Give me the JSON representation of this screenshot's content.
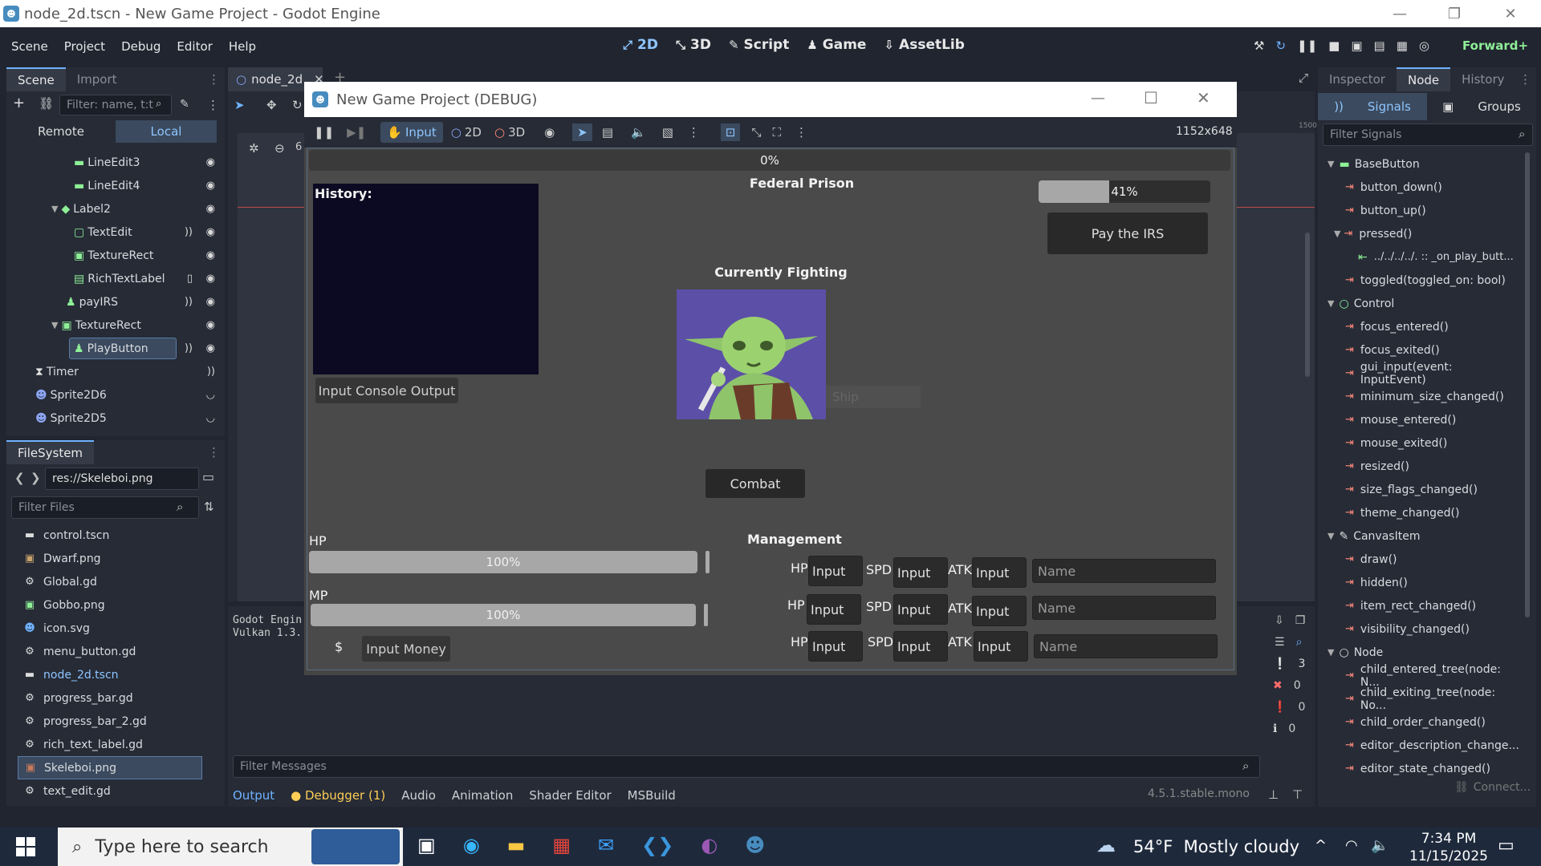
{
  "window": {
    "title": "node_2d.tscn - New Game Project - Godot Engine"
  },
  "menu": [
    "Scene",
    "Project",
    "Debug",
    "Editor",
    "Help"
  ],
  "workspaces": [
    {
      "label": "2D",
      "icon": "2d-icon",
      "active": true
    },
    {
      "label": "3D",
      "icon": "3d-icon",
      "active": false
    },
    {
      "label": "Script",
      "icon": "script-icon",
      "active": false
    },
    {
      "label": "Game",
      "icon": "game-icon",
      "active": false
    },
    {
      "label": "AssetLib",
      "icon": "assetlib-icon",
      "active": false
    }
  ],
  "renderer": "Forward+",
  "scene_dock": {
    "tabs": [
      "Scene",
      "Import"
    ],
    "filter_placeholder": "Filter: name, t:t",
    "remote": "Remote",
    "local": "Local",
    "nodes": [
      {
        "label": "LineEdit3",
        "depth": 3,
        "icon": "lineedit-icon",
        "color": "#8eef97"
      },
      {
        "label": "LineEdit4",
        "depth": 3,
        "icon": "lineedit-icon",
        "color": "#8eef97"
      },
      {
        "label": "Label2",
        "depth": 2,
        "icon": "label-icon",
        "color": "#8eef97"
      },
      {
        "label": "TextEdit",
        "depth": 3,
        "icon": "textedit-icon",
        "color": "#8eef97"
      },
      {
        "label": "TextureRect",
        "depth": 3,
        "icon": "texturerect-icon",
        "color": "#8eef97"
      },
      {
        "label": "RichTextLabel",
        "depth": 3,
        "icon": "richtextlabel-icon",
        "color": "#8eef97"
      },
      {
        "label": "payIRS",
        "depth": 2,
        "icon": "button-icon",
        "color": "#8eef97"
      },
      {
        "label": "TextureRect",
        "depth": 2,
        "icon": "texturerect-icon",
        "color": "#8eef97"
      },
      {
        "label": "PlayButton",
        "depth": 3,
        "icon": "button-icon",
        "color": "#8eef97"
      },
      {
        "label": "Timer",
        "depth": 1,
        "icon": "timer-icon",
        "color": "#e0e0e0"
      },
      {
        "label": "Sprite2D6",
        "depth": 1,
        "icon": "sprite-icon",
        "color": "#8da5f3"
      },
      {
        "label": "Sprite2D5",
        "depth": 1,
        "icon": "sprite-icon",
        "color": "#8da5f3"
      }
    ]
  },
  "filesystem": {
    "title": "FileSystem",
    "path": "res://Skeleboi.png",
    "filter_placeholder": "Filter Files",
    "files": [
      "control.tscn",
      "Dwarf.png",
      "Global.gd",
      "Gobbo.png",
      "icon.svg",
      "menu_button.gd",
      "node_2d.tscn",
      "progress_bar.gd",
      "progress_bar_2.gd",
      "rich_text_label.gd",
      "Skeleboi.png",
      "text_edit.gd"
    ]
  },
  "editor": {
    "tab": "node_2d",
    "log_line1": "Godot Engin",
    "log_line2": "Vulkan 1.3.",
    "zoom_fragment": "6",
    "ruler_1500": "1500",
    "filter_messages": "Filter Messages",
    "counts": [
      "3",
      "0",
      "0",
      "0"
    ]
  },
  "bottom_tabs": [
    "Output",
    "Debugger (1)",
    "Audio",
    "Animation",
    "Shader Editor",
    "MSBuild"
  ],
  "version": "4.5.1.stable.mono",
  "debug_window": {
    "title": "New Game Project (DEBUG)",
    "toolbar": {
      "input": "Input",
      "d2": "2D",
      "d3": "3D",
      "resolution": "1152x648"
    },
    "top_progress": "0%",
    "location": "Federal Prison",
    "history_label": "History:",
    "input_console_button": "Input Console Output",
    "irs_progress_text": "41%",
    "irs_progress": 0.41,
    "pay_irs_button": "Pay the IRS",
    "currently_fighting": "Currently Fighting",
    "ghost_text": "Ship",
    "combat_button": "Combat",
    "hp_label": "HP",
    "hp_text": "100%",
    "hp_value": 1.0,
    "mp_label": "MP",
    "mp_text": "100%",
    "mp_value": 1.0,
    "money_symbol": "$",
    "money_button": "Input Money",
    "management": "Management",
    "rows": [
      {
        "hp": "HP",
        "hp_val": "Input",
        "spd": "SPD",
        "spd_val": "Input",
        "atk": "ATK",
        "atk_val": "Input",
        "name": "Name"
      },
      {
        "hp": "HP",
        "hp_val": "Input",
        "spd": "SPD",
        "spd_val": "Input",
        "atk": "ATK",
        "atk_val": "Input",
        "name": "Name"
      },
      {
        "hp": "HP",
        "hp_val": "Input",
        "spd": "SPD",
        "spd_val": "Input",
        "atk": "ATK",
        "atk_val": "Input",
        "name": "Name"
      }
    ]
  },
  "inspector": {
    "tabs": [
      "Inspector",
      "Node",
      "History"
    ],
    "subtabs": [
      "Signals",
      "Groups"
    ],
    "filter_placeholder": "Filter Signals",
    "connect": "Connect...",
    "entries": [
      {
        "type": "header",
        "label": "BaseButton"
      },
      {
        "type": "signal",
        "label": "button_down()"
      },
      {
        "type": "signal",
        "label": "button_up()"
      },
      {
        "type": "signal",
        "label": "pressed()"
      },
      {
        "type": "conn",
        "label": "../../../../. :: _on_play_butt..."
      },
      {
        "type": "signal",
        "label": "toggled(toggled_on: bool)"
      },
      {
        "type": "header",
        "label": "Control"
      },
      {
        "type": "signal",
        "label": "focus_entered()"
      },
      {
        "type": "signal",
        "label": "focus_exited()"
      },
      {
        "type": "signal",
        "label": "gui_input(event: InputEvent)"
      },
      {
        "type": "signal",
        "label": "minimum_size_changed()"
      },
      {
        "type": "signal",
        "label": "mouse_entered()"
      },
      {
        "type": "signal",
        "label": "mouse_exited()"
      },
      {
        "type": "signal",
        "label": "resized()"
      },
      {
        "type": "signal",
        "label": "size_flags_changed()"
      },
      {
        "type": "signal",
        "label": "theme_changed()"
      },
      {
        "type": "header",
        "label": "CanvasItem"
      },
      {
        "type": "signal",
        "label": "draw()"
      },
      {
        "type": "signal",
        "label": "hidden()"
      },
      {
        "type": "signal",
        "label": "item_rect_changed()"
      },
      {
        "type": "signal",
        "label": "visibility_changed()"
      },
      {
        "type": "header",
        "label": "Node"
      },
      {
        "type": "signal",
        "label": "child_entered_tree(node: N..."
      },
      {
        "type": "signal",
        "label": "child_exiting_tree(node: No..."
      },
      {
        "type": "signal",
        "label": "child_order_changed()"
      },
      {
        "type": "signal",
        "label": "editor_description_change..."
      },
      {
        "type": "signal",
        "label": "editor_state_changed()"
      }
    ]
  },
  "taskbar": {
    "search_placeholder": "Type here to search",
    "weather": "54°F  Mostly cloudy",
    "time": "7:34 PM",
    "date": "11/15/2025"
  }
}
